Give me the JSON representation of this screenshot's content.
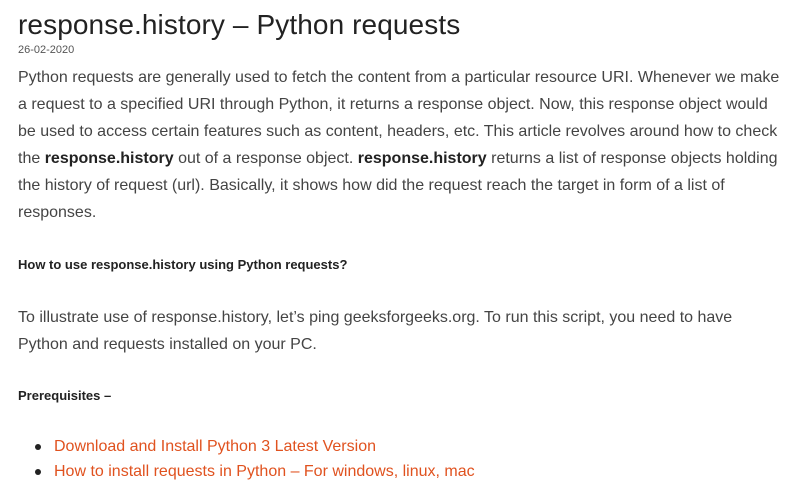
{
  "article": {
    "title": "response.history – Python requests",
    "date": "26-02-2020",
    "intro": {
      "part1": "Python requests are generally used to fetch the content from a particular resource URI. Whenever we make a request to a specified URI through Python, it returns a response object. Now, this response object would be used to access certain features such as content, headers, etc. This article revolves around how to check the ",
      "bold1": "response.history",
      "part2": " out of a response object. ",
      "bold2": "response.history",
      "part3": " returns a list of response objects holding the history of request (url). Basically, it shows how did the request reach the target in form of a list of responses."
    },
    "subheading1": "How to use response.history using Python requests?",
    "paragraph2": "To illustrate use of response.history, let’s ping geeksforgeeks.org. To run this script, you need to have Python and requests installed on your PC.",
    "subheading2": "Prerequisites –",
    "links": [
      {
        "label": "Download and Install Python 3 Latest Version"
      },
      {
        "label": "How to install requests in Python – For windows, linux, mac"
      }
    ],
    "colors": {
      "link": "#e0521f",
      "heading": "#222222",
      "body_text": "#444444"
    }
  }
}
